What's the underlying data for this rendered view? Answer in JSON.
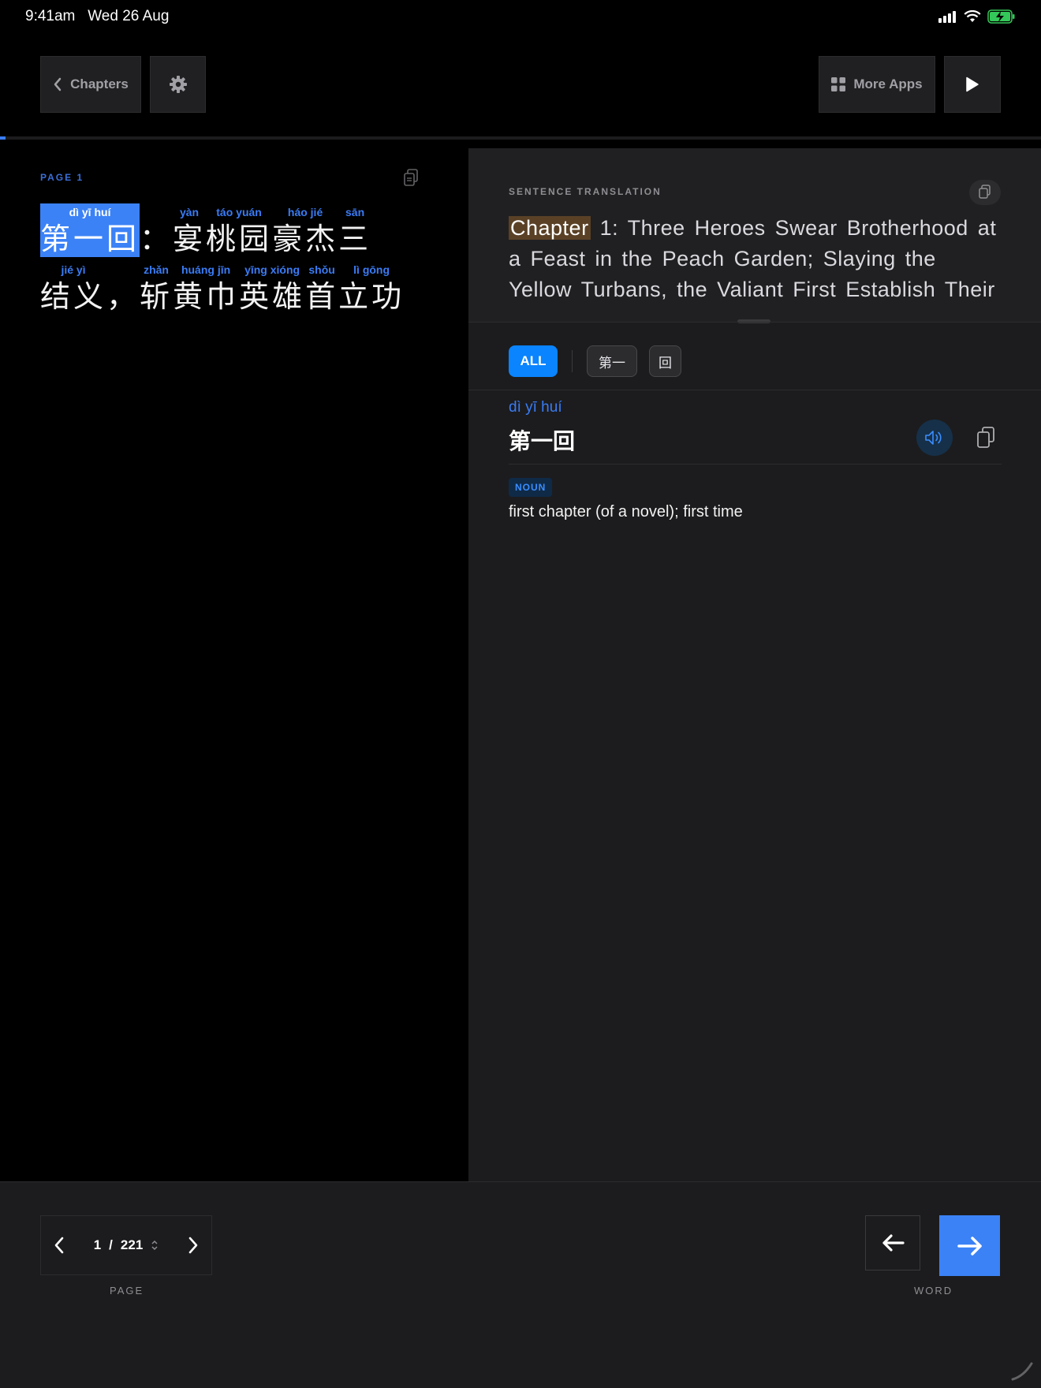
{
  "status_bar": {
    "time": "9:41am",
    "date": "Wed 26 Aug"
  },
  "toolbar": {
    "chapters_label": "Chapters",
    "more_apps_label": "More Apps"
  },
  "reading_progress": 0.005,
  "reader": {
    "page_label": "PAGE  1",
    "lines": [
      [
        {
          "pinyin": "dì yī huí",
          "hanzi": "第一回",
          "selected": true
        },
        {
          "pinyin": "",
          "hanzi": "："
        },
        {
          "pinyin": "yàn",
          "hanzi": "宴"
        },
        {
          "pinyin": "táo yuán",
          "hanzi": "桃园"
        },
        {
          "pinyin": "háo jié",
          "hanzi": "豪杰"
        },
        {
          "pinyin": "sān",
          "hanzi": "三"
        }
      ],
      [
        {
          "pinyin": "jié yì",
          "hanzi": "结义"
        },
        {
          "pinyin": "",
          "hanzi": "，"
        },
        {
          "pinyin": "zhǎn",
          "hanzi": "斩"
        },
        {
          "pinyin": "huáng jīn",
          "hanzi": "黄巾"
        },
        {
          "pinyin": "yīng xióng",
          "hanzi": "英雄"
        },
        {
          "pinyin": "shǒu",
          "hanzi": "首"
        },
        {
          "pinyin": "lì gōng",
          "hanzi": "立功"
        }
      ]
    ]
  },
  "translation": {
    "label": "SENTENCE TRANSLATION",
    "highlight": "Chapter",
    "text": " 1: Three Heroes Swear Brotherhood at a Feast in the Peach Garden; Slaying the Yellow Turbans, the Valiant First Establish Their"
  },
  "filters": {
    "all": "ALL",
    "items": [
      "第一",
      "回"
    ]
  },
  "definition": {
    "pinyin": "dì yī huí",
    "hanzi": "第一回",
    "part_of_speech": "NOUN",
    "meaning": "first chapter (of a novel); first time"
  },
  "pager": {
    "current": "1",
    "separator": "/",
    "total": "221",
    "caption": "PAGE"
  },
  "word_nav": {
    "caption": "WORD"
  },
  "colors": {
    "accent": "#3b82f6",
    "chip_active": "#0a84ff",
    "highlight": "#5a4126"
  }
}
